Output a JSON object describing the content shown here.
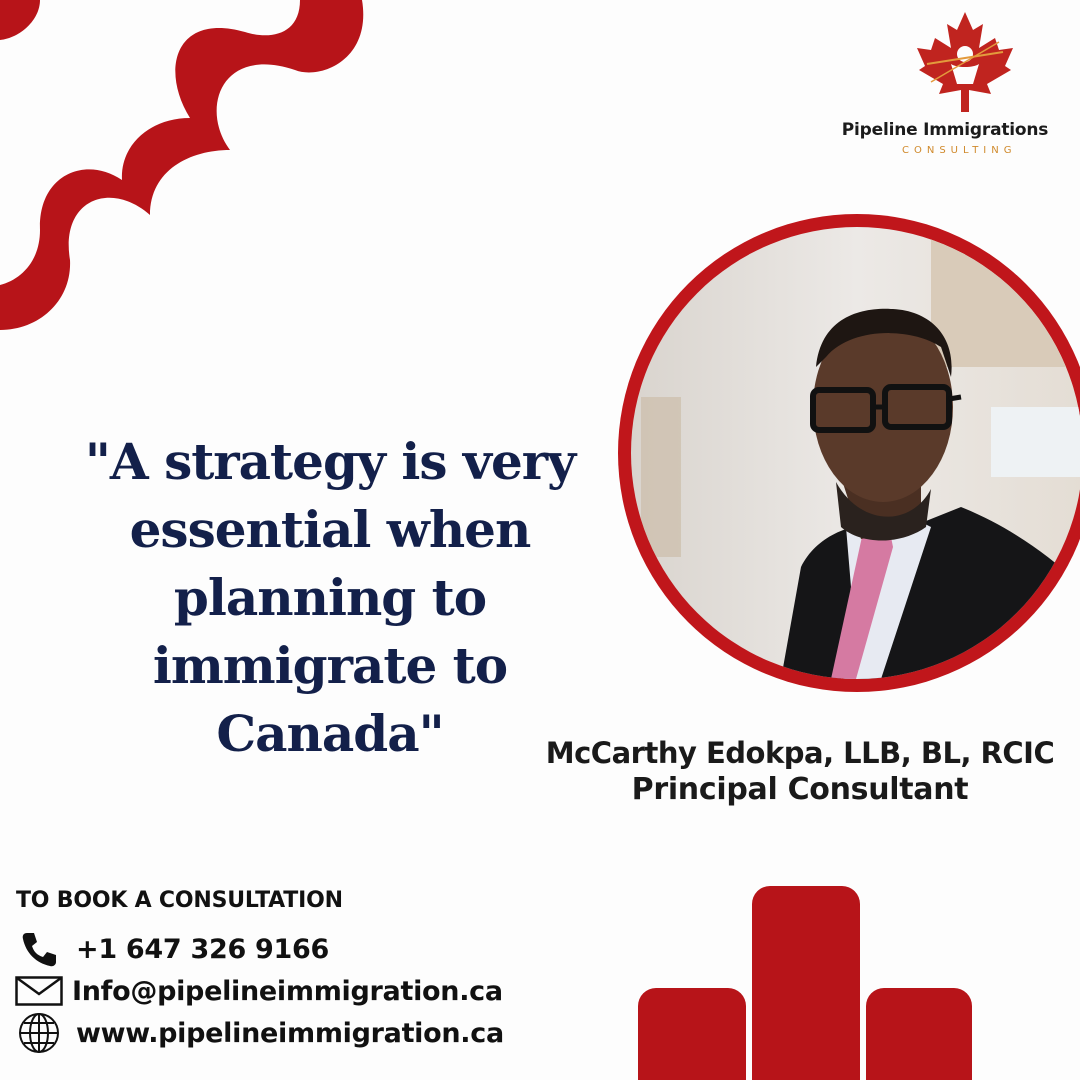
{
  "brand": {
    "name": "Pipeline Immigrations",
    "tagline": "CONSULTING"
  },
  "quote": {
    "lines": [
      "\"A strategy is very",
      "essential when",
      "planning to",
      "immigrate to Canada\""
    ]
  },
  "attribution": {
    "name": "McCarthy Edokpa, LLB, BL, RCIC",
    "role": "Principal Consultant"
  },
  "contact": {
    "heading": "TO BOOK A CONSULTATION",
    "phone": "+1 647 326 9166",
    "email": "Info@pipelineimmigration.ca",
    "website": "www.pipelineimmigration.ca",
    "icons": {
      "phone": "phone-icon",
      "email": "envelope-icon",
      "website": "globe-icon"
    }
  },
  "colors": {
    "accent": "#b71419",
    "navy": "#13204a",
    "gold": "#d08a2c"
  }
}
